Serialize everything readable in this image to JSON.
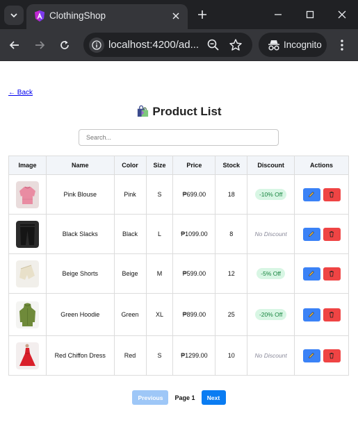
{
  "browser": {
    "tab_title": "ClothingShop",
    "url": "localhost:4200/ad...",
    "incognito_label": "Incognito"
  },
  "page": {
    "back_link": "← Back",
    "title": "Product List",
    "search_placeholder": "Search..."
  },
  "table": {
    "headers": [
      "Image",
      "Name",
      "Color",
      "Size",
      "Price",
      "Stock",
      "Discount",
      "Actions"
    ],
    "rows": [
      {
        "name": "Pink Blouse",
        "color": "Pink",
        "size": "S",
        "price": "₱699.00",
        "stock": "18",
        "discount": "-10% Off",
        "has_discount": true
      },
      {
        "name": "Black Slacks",
        "color": "Black",
        "size": "L",
        "price": "₱1099.00",
        "stock": "8",
        "discount": "No Discount",
        "has_discount": false
      },
      {
        "name": "Beige Shorts",
        "color": "Beige",
        "size": "M",
        "price": "₱599.00",
        "stock": "12",
        "discount": "-5% Off",
        "has_discount": true
      },
      {
        "name": "Green Hoodie",
        "color": "Green",
        "size": "XL",
        "price": "₱899.00",
        "stock": "25",
        "discount": "-20% Off",
        "has_discount": true
      },
      {
        "name": "Red Chiffon Dress",
        "color": "Red",
        "size": "S",
        "price": "₱1299.00",
        "stock": "10",
        "discount": "No Discount",
        "has_discount": false
      }
    ]
  },
  "pagination": {
    "previous": "Previous",
    "page_label": "Page 1",
    "next": "Next"
  },
  "icons": {
    "edit": "pencil-icon",
    "delete": "trash-icon",
    "title": "shopping-bags-icon"
  },
  "colors": {
    "edit_button": "#3b82f6",
    "delete_button": "#ef4444",
    "discount_badge_bg": "#d8f6e4",
    "discount_badge_text": "#16833e",
    "next_button": "#0a7cf2",
    "previous_button_disabled": "#9ec7f7"
  }
}
